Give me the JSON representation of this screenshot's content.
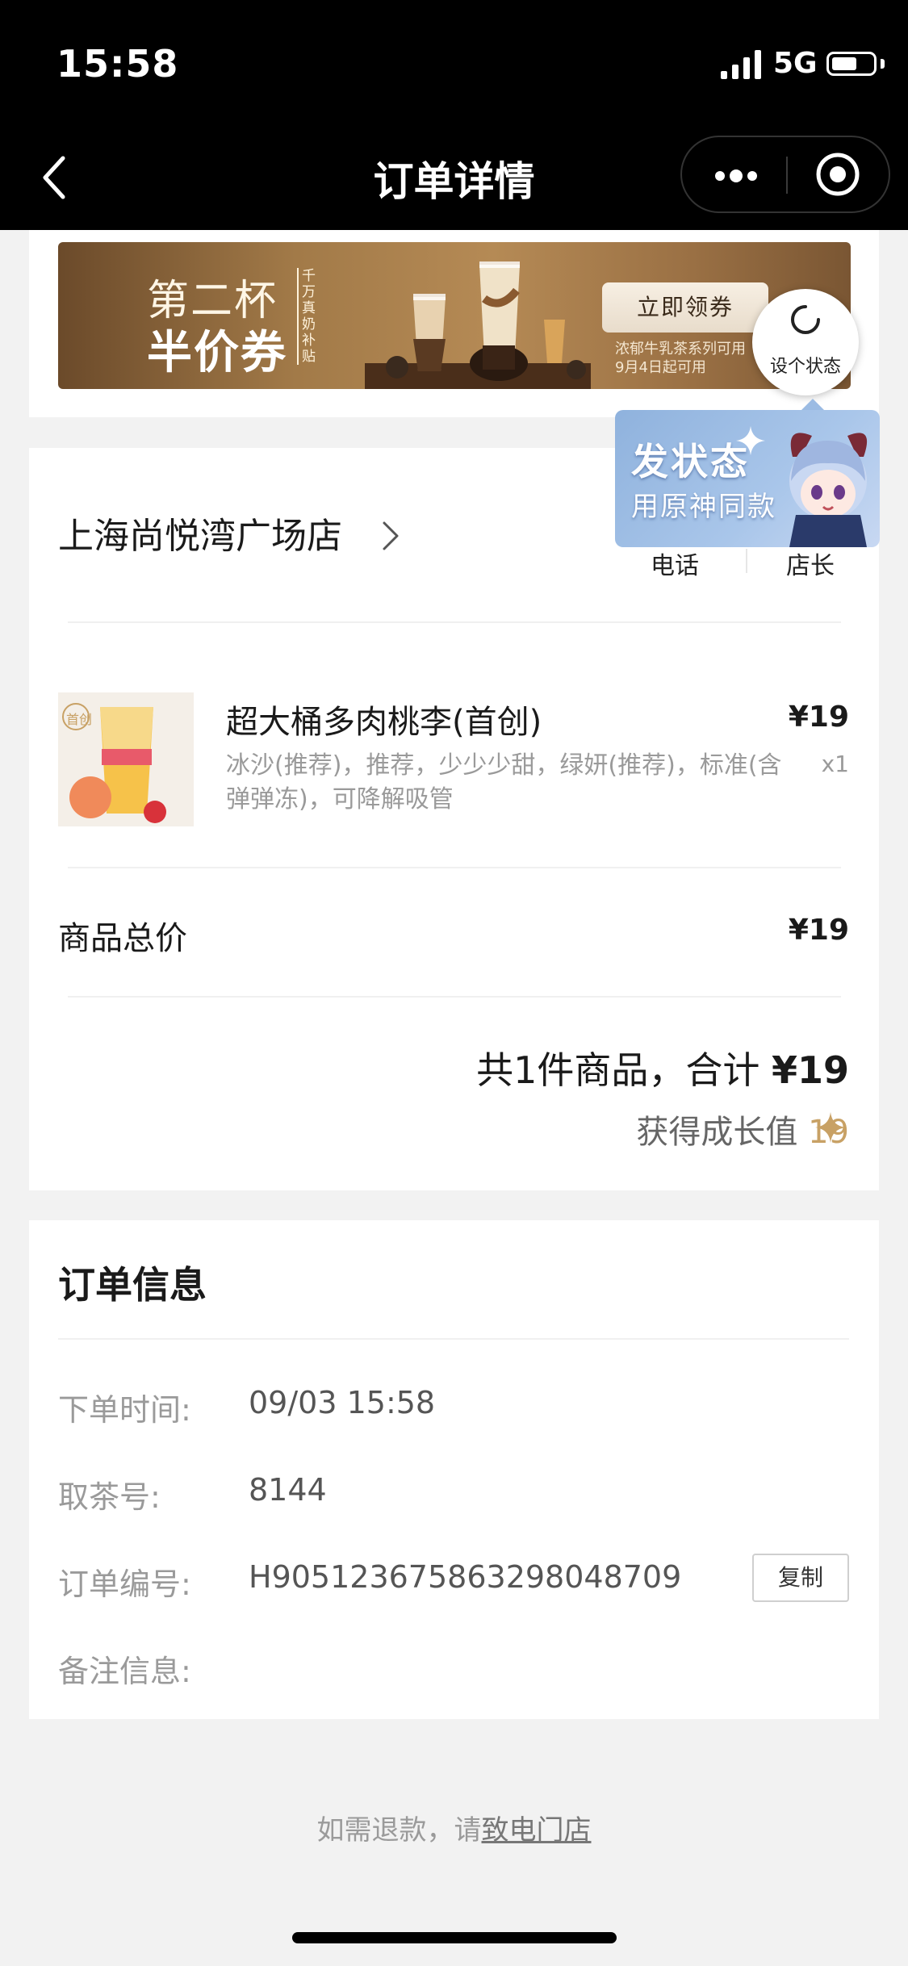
{
  "status_bar": {
    "time": "15:58",
    "network": "5G",
    "battery_level": 0.6
  },
  "nav": {
    "title": "订单详情"
  },
  "banner": {
    "line1": "第二杯",
    "line2": "半价券",
    "vertical_text": "千万真奶补贴",
    "button": "立即领券",
    "sub1": "浓郁牛乳茶系列可用",
    "sub2": "9月4日起可用"
  },
  "status_widget": {
    "label": "设个状态",
    "popup_title": "发状态",
    "popup_subtitle": "用原神同款"
  },
  "store": {
    "name": "上海尚悦湾广场店",
    "phone_label": "电话",
    "manager_label": "店长"
  },
  "product": {
    "image_text": "首创",
    "name": "超大桶多肉桃李(首创)",
    "options": "冰沙(推荐)，推荐，少少少甜，绿妍(推荐)，标准(含弹弹冻)，可降解吸管",
    "price": "¥19",
    "qty": "x1"
  },
  "subtotal": {
    "label": "商品总价",
    "value": "¥19"
  },
  "total": {
    "prefix": "共1件商品，合计 ",
    "amount": "¥19"
  },
  "growth": {
    "label": "获得成长值 ",
    "value": "19"
  },
  "order_info": {
    "title": "订单信息",
    "rows": [
      {
        "label": "下单时间:",
        "value": "09/03 15:58"
      },
      {
        "label": "取茶号:",
        "value": "8144"
      },
      {
        "label": "订单编号:",
        "value": "H9051236758632980487​09"
      },
      {
        "label": "备注信息:",
        "value": ""
      }
    ],
    "copy_button": "复制"
  },
  "footer": {
    "refund_prefix": "如需退款，请",
    "refund_link": "致电门店"
  },
  "colors": {
    "gold": "#c8a165",
    "nav_bg": "#000000",
    "page_bg": "#f2f2f2"
  }
}
